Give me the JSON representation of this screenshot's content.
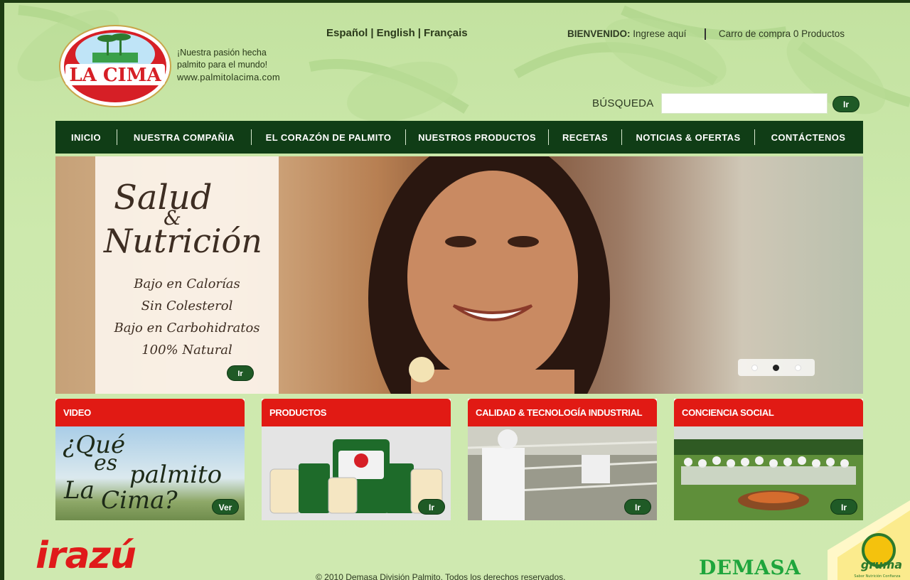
{
  "header": {
    "logo_text": "LA CIMA",
    "tagline": [
      "¡Nuestra pasión hecha",
      "palmito para el mundo!"
    ],
    "url": "www.palmitolacima.com",
    "languages": [
      "Español",
      "English",
      "Français"
    ],
    "welcome_label": "BIENVENIDO:",
    "login_link": "Ingrese aquí",
    "cart_text": "Carro de compra 0 Productos",
    "search_label": "BÚSQUEDA",
    "search_value": "",
    "search_button": "Ir"
  },
  "nav": {
    "items": [
      "INICIO",
      "NUESTRA COMPAÑIA",
      "EL CORAZÓN DE PALMITO",
      "NUESTROS PRODUCTOS",
      "RECETAS",
      "NOTICIAS & OFERTAS",
      "CONTÁCTENOS"
    ]
  },
  "hero": {
    "title_line1": "Salud",
    "title_amp": "&",
    "title_line2": "Nutrición",
    "claims": [
      "Bajo en Calorías",
      "Sin Colesterol",
      "Bajo en Carbohidratos",
      "100% Natural"
    ],
    "button": "Ir",
    "slide_active": 2,
    "slide_count": 3
  },
  "cards": [
    {
      "title": "VIDEO",
      "button": "Ver",
      "image_text": [
        "¿Qué",
        "es",
        "palmito",
        "La",
        "Cima?"
      ]
    },
    {
      "title": "PRODUCTOS",
      "button": "Ir"
    },
    {
      "title": "CALIDAD & TECNOLOGÍA INDUSTRIAL",
      "button": "Ir"
    },
    {
      "title": "CONCIENCIA SOCIAL",
      "button": "Ir"
    }
  ],
  "footer": {
    "irazu_logo": "irazú",
    "copyright": "© 2010 Demasa División Palmito. Todos los derechos reservados.",
    "demasa_logo": "DEMASA",
    "gruma_logo": "gruma",
    "gruma_slogan": "Sabor Nutrición Confianza"
  },
  "colors": {
    "nav_bg": "#103d16",
    "card_header": "#e11a14",
    "button_green": "#1f5a26",
    "page_bg": "#c9e6a8"
  }
}
